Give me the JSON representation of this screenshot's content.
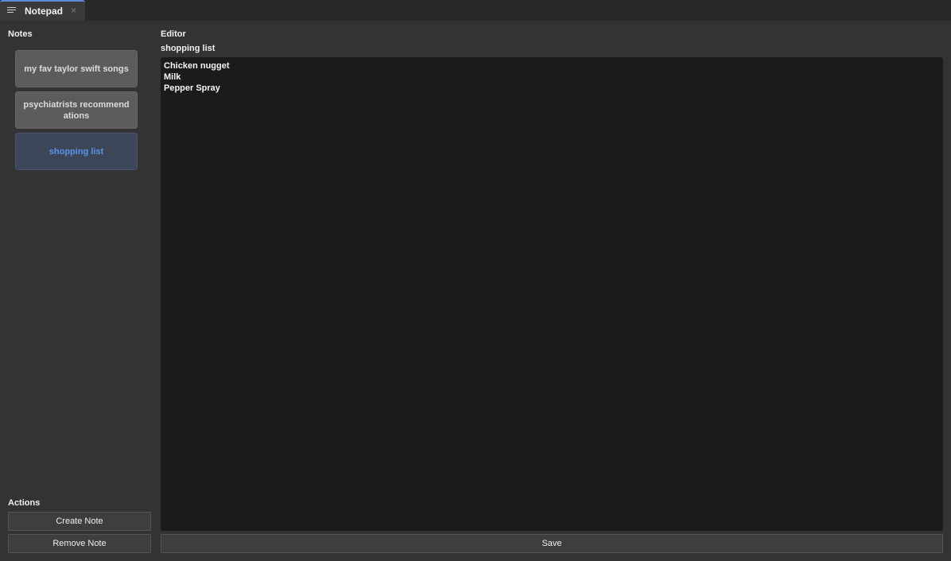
{
  "tab": {
    "title": "Notepad",
    "close_glyph": "×",
    "menu_icon": "hamburger-menu-icon"
  },
  "sidebar": {
    "title": "Notes",
    "notes": [
      {
        "label": "my fav taylor swift songs",
        "selected": false
      },
      {
        "label": "psychiatrists recommend ations",
        "selected": false
      },
      {
        "label": "shopping list",
        "selected": true
      }
    ],
    "actions_title": "Actions",
    "create_label": "Create Note",
    "remove_label": "Remove Note"
  },
  "editor": {
    "title": "Editor",
    "note_name": "shopping list",
    "content": "Chicken nugget\nMilk\nPepper Spray",
    "save_label": "Save"
  },
  "colors": {
    "accent": "#5a94ea",
    "tab_accent": "#5a8ad8"
  }
}
